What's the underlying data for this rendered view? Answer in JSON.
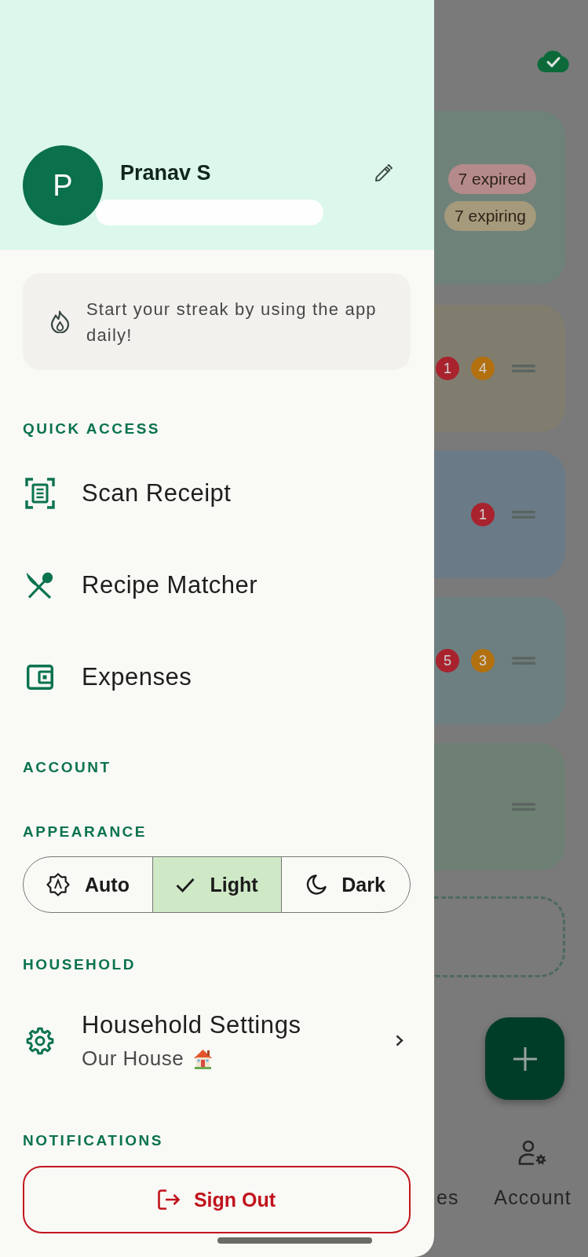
{
  "drawer": {
    "profile": {
      "initial": "P",
      "name": "Pranav S"
    },
    "streak": {
      "message": "Start your streak by using the app daily!"
    },
    "quick_access": {
      "title": "QUICK ACCESS",
      "items": [
        {
          "label": "Scan Receipt"
        },
        {
          "label": "Recipe Matcher"
        },
        {
          "label": "Expenses"
        }
      ]
    },
    "account": {
      "title": "ACCOUNT"
    },
    "appearance": {
      "title": "APPEARANCE",
      "options": [
        {
          "label": "Auto",
          "selected": false
        },
        {
          "label": "Light",
          "selected": true
        },
        {
          "label": "Dark",
          "selected": false
        }
      ]
    },
    "household": {
      "title": "HOUSEHOLD",
      "settings": {
        "label": "Household Settings",
        "subtitle": "Our House"
      }
    },
    "notifications": {
      "title": "NOTIFICATIONS"
    },
    "sign_out": {
      "label": "Sign Out"
    }
  },
  "background": {
    "summary_card": {
      "color": "#6f8279",
      "pills": [
        {
          "label": "7 expired",
          "color": "#b58a8b"
        },
        {
          "label": "7 expiring",
          "color": "#a59a7c"
        }
      ]
    },
    "cards": [
      {
        "color": "#807d6f",
        "badges": [
          {
            "count": "1",
            "color": "#a8232d"
          },
          {
            "count": "4",
            "color": "#b2700f"
          }
        ]
      },
      {
        "color": "#6a7a86",
        "badges": [
          {
            "count": "1",
            "color": "#a8232d"
          }
        ]
      },
      {
        "color": "#6d7f80",
        "badges": [
          {
            "count": "5",
            "color": "#a8232d"
          },
          {
            "count": "3",
            "color": "#b2700f"
          }
        ]
      },
      {
        "color": "#6e7f74"
      }
    ],
    "bottom_nav": [
      {
        "label": "es"
      },
      {
        "label": "Account"
      }
    ]
  }
}
